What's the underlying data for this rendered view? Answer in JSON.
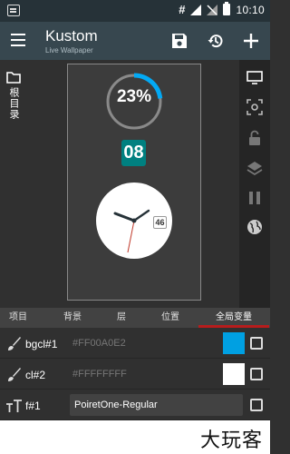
{
  "status_bar": {
    "time": "10:10",
    "hash_icon": "#"
  },
  "app_bar": {
    "title": "Kustom",
    "subtitle": "Live Wallpaper",
    "icons": [
      "menu-icon",
      "save-icon",
      "history-icon",
      "add-icon"
    ]
  },
  "left_bar": {
    "folder_label": "根目录",
    "icon": "folder-icon"
  },
  "preview": {
    "progress_text": "23%",
    "progress_value": 0.23,
    "number_badge": "08",
    "clock_day": "46",
    "accent": "#03a9f4",
    "badge_color": "#008080"
  },
  "right_bar": {
    "icons": [
      "monitor-icon",
      "focus-icon",
      "lock-icon",
      "layers-icon",
      "pause-icon",
      "globe-icon"
    ]
  },
  "tabs": [
    {
      "label": "项目"
    },
    {
      "label": "背景"
    },
    {
      "label": "层"
    },
    {
      "label": "位置"
    },
    {
      "label": "全局变量",
      "active": true
    }
  ],
  "globals": [
    {
      "name": "bgcl#1",
      "value": "#FF00A0E2",
      "icon": "brush-icon",
      "swatch": "#00a0e2"
    },
    {
      "name": "cl#2",
      "value": "#FFFFFFFF",
      "icon": "brush-icon",
      "swatch": "#ffffff"
    },
    {
      "name": "f#1",
      "value": "PoiretOne-Regular",
      "icon": "font-icon"
    }
  ],
  "watermark": "大玩客"
}
